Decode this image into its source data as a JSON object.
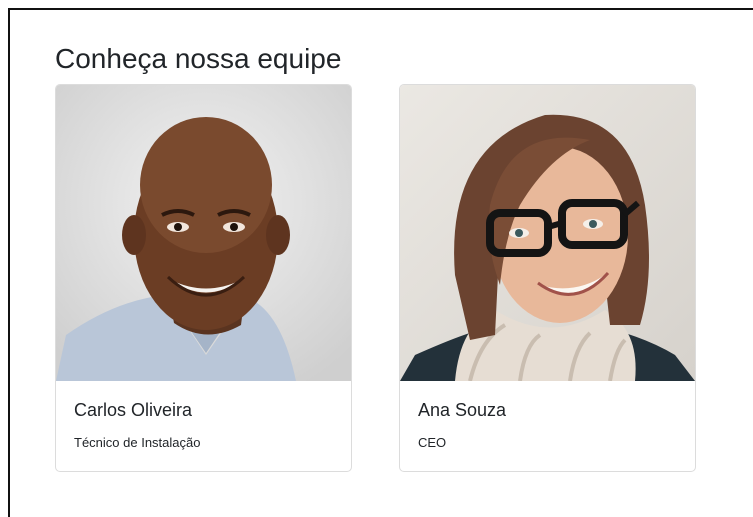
{
  "team": {
    "heading": "Conheça nossa equipe",
    "members": [
      {
        "name": "Carlos Oliveira",
        "role": "Técnico de Instalação"
      },
      {
        "name": "Ana Souza",
        "role": "CEO"
      }
    ]
  }
}
